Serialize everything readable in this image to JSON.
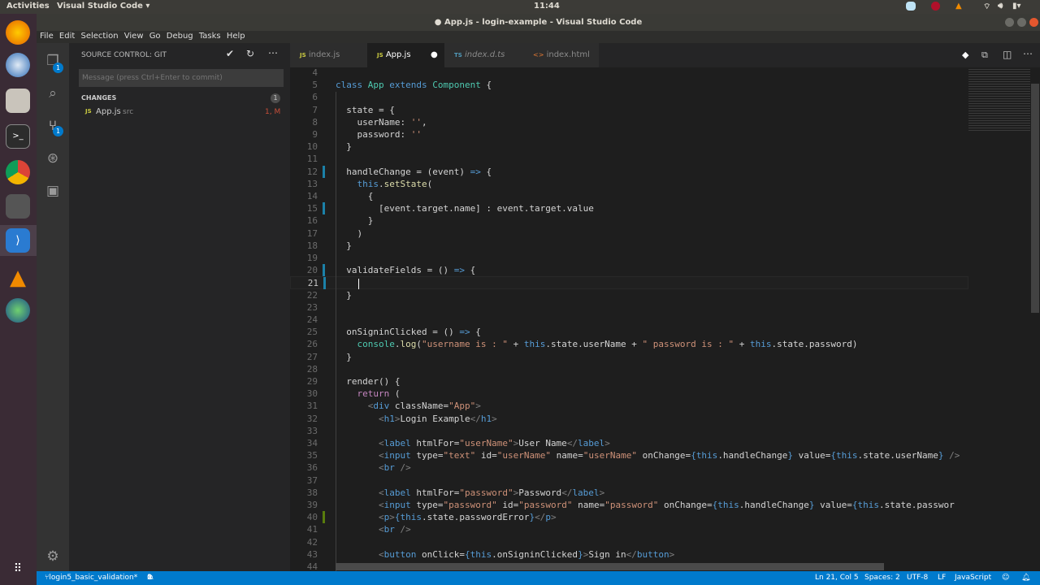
{
  "system": {
    "activities": "Activities",
    "app_menu": "Visual Studio Code ▾",
    "clock": "11:44"
  },
  "window": {
    "title": "● App.js - login-example - Visual Studio Code"
  },
  "menu": [
    "File",
    "Edit",
    "Selection",
    "View",
    "Go",
    "Debug",
    "Tasks",
    "Help"
  ],
  "activity": {
    "explorer_badge": "1",
    "git_badge": "1"
  },
  "sidebar": {
    "title": "SOURCE CONTROL: GIT",
    "commit_placeholder": "Message (press Ctrl+Enter to commit)",
    "changes_label": "CHANGES",
    "changes_count": "1",
    "files": [
      {
        "icon": "JS",
        "name": "App.js",
        "dir": "src",
        "status": "1, M"
      }
    ]
  },
  "tabs": [
    {
      "icon": "JS",
      "label": "index.js"
    },
    {
      "icon": "JS",
      "label": "App.js",
      "dirty": "●"
    },
    {
      "icon": "TS",
      "label": "index.d.ts"
    },
    {
      "icon": "<>",
      "label": "index.html"
    }
  ],
  "editor": {
    "cursor_line": 21,
    "lines": [
      [
        4,
        []
      ],
      [
        5,
        [
          [
            "class",
            "kw"
          ],
          [
            " ",
            "pl"
          ],
          [
            "App",
            "cls"
          ],
          [
            " ",
            "pl"
          ],
          [
            "extends",
            "kw"
          ],
          [
            " ",
            "pl"
          ],
          [
            "Component",
            "cls"
          ],
          [
            " {",
            "pl"
          ]
        ]
      ],
      [
        6,
        []
      ],
      [
        7,
        [
          [
            "  state = {",
            "pl"
          ]
        ]
      ],
      [
        8,
        [
          [
            "    userName: ",
            "pl"
          ],
          [
            "''",
            "str"
          ],
          [
            ",",
            "pl"
          ]
        ]
      ],
      [
        9,
        [
          [
            "    password: ",
            "pl"
          ],
          [
            "''",
            "str"
          ]
        ]
      ],
      [
        10,
        [
          [
            "  }",
            "pl"
          ]
        ]
      ],
      [
        11,
        []
      ],
      [
        12,
        [
          [
            "  handleChange = (event) ",
            "pl"
          ],
          [
            "=>",
            "kw"
          ],
          [
            " {",
            "pl"
          ]
        ]
      ],
      [
        13,
        [
          [
            "    ",
            "pl"
          ],
          [
            "this",
            "ths"
          ],
          [
            ".",
            "pl"
          ],
          [
            "setState",
            "fn"
          ],
          [
            "(",
            "pl"
          ]
        ]
      ],
      [
        14,
        [
          [
            "      {",
            "pl"
          ]
        ]
      ],
      [
        15,
        [
          [
            "        [event.target.name] : event.target.value",
            "pl"
          ]
        ]
      ],
      [
        16,
        [
          [
            "      }",
            "pl"
          ]
        ]
      ],
      [
        17,
        [
          [
            "    )",
            "pl"
          ]
        ]
      ],
      [
        18,
        [
          [
            "  }",
            "pl"
          ]
        ]
      ],
      [
        19,
        []
      ],
      [
        20,
        [
          [
            "  validateFields = () ",
            "pl"
          ],
          [
            "=>",
            "kw"
          ],
          [
            " {",
            "pl"
          ]
        ]
      ],
      [
        21,
        [
          [
            "    ",
            "pl"
          ]
        ]
      ],
      [
        22,
        [
          [
            "  }",
            "pl"
          ]
        ]
      ],
      [
        23,
        []
      ],
      [
        24,
        []
      ],
      [
        25,
        [
          [
            "  onSigninClicked = () ",
            "pl"
          ],
          [
            "=>",
            "kw"
          ],
          [
            " {",
            "pl"
          ]
        ]
      ],
      [
        26,
        [
          [
            "    ",
            "pl"
          ],
          [
            "console",
            "obj"
          ],
          [
            ".",
            "pl"
          ],
          [
            "log",
            "fn"
          ],
          [
            "(",
            "pl"
          ],
          [
            "\"username is : \"",
            "str"
          ],
          [
            " + ",
            "pl"
          ],
          [
            "this",
            "ths"
          ],
          [
            ".state.userName + ",
            "pl"
          ],
          [
            "\" password is : \"",
            "str"
          ],
          [
            " + ",
            "pl"
          ],
          [
            "this",
            "ths"
          ],
          [
            ".state.password)",
            "pl"
          ]
        ]
      ],
      [
        27,
        [
          [
            "  }",
            "pl"
          ]
        ]
      ],
      [
        28,
        []
      ],
      [
        29,
        [
          [
            "  render() {",
            "pl"
          ]
        ]
      ],
      [
        30,
        [
          [
            "    ",
            "pl"
          ],
          [
            "return",
            "ret"
          ],
          [
            " (",
            "pl"
          ]
        ]
      ],
      [
        31,
        [
          [
            "      ",
            "pl"
          ],
          [
            "<",
            "tg"
          ],
          [
            "div",
            "tn"
          ],
          [
            " className=",
            "at"
          ],
          [
            "\"App\"",
            "str"
          ],
          [
            ">",
            "tg"
          ]
        ]
      ],
      [
        32,
        [
          [
            "        ",
            "pl"
          ],
          [
            "<",
            "tg"
          ],
          [
            "h1",
            "tn"
          ],
          [
            ">",
            "tg"
          ],
          [
            "Login Example",
            "pl"
          ],
          [
            "</",
            "tg"
          ],
          [
            "h1",
            "tn"
          ],
          [
            ">",
            "tg"
          ]
        ]
      ],
      [
        33,
        []
      ],
      [
        34,
        [
          [
            "        ",
            "pl"
          ],
          [
            "<",
            "tg"
          ],
          [
            "label",
            "tn"
          ],
          [
            " htmlFor=",
            "at"
          ],
          [
            "\"userName\"",
            "str"
          ],
          [
            ">",
            "tg"
          ],
          [
            "User Name",
            "pl"
          ],
          [
            "</",
            "tg"
          ],
          [
            "label",
            "tn"
          ],
          [
            ">",
            "tg"
          ]
        ]
      ],
      [
        35,
        [
          [
            "        ",
            "pl"
          ],
          [
            "<",
            "tg"
          ],
          [
            "input",
            "tn"
          ],
          [
            " type=",
            "at"
          ],
          [
            "\"text\"",
            "str"
          ],
          [
            " id=",
            "at"
          ],
          [
            "\"userName\"",
            "str"
          ],
          [
            " name=",
            "at"
          ],
          [
            "\"userName\"",
            "str"
          ],
          [
            " onChange=",
            "at"
          ],
          [
            "{",
            "ths"
          ],
          [
            "this",
            "ths"
          ],
          [
            ".handleChange",
            "pl"
          ],
          [
            "}",
            "ths"
          ],
          [
            " value=",
            "at"
          ],
          [
            "{",
            "ths"
          ],
          [
            "this",
            "ths"
          ],
          [
            ".state.userName",
            "pl"
          ],
          [
            "}",
            "ths"
          ],
          [
            " />",
            "tg"
          ]
        ]
      ],
      [
        36,
        [
          [
            "        ",
            "pl"
          ],
          [
            "<",
            "tg"
          ],
          [
            "br",
            "tn"
          ],
          [
            " />",
            "tg"
          ]
        ]
      ],
      [
        37,
        []
      ],
      [
        38,
        [
          [
            "        ",
            "pl"
          ],
          [
            "<",
            "tg"
          ],
          [
            "label",
            "tn"
          ],
          [
            " htmlFor=",
            "at"
          ],
          [
            "\"password\"",
            "str"
          ],
          [
            ">",
            "tg"
          ],
          [
            "Password",
            "pl"
          ],
          [
            "</",
            "tg"
          ],
          [
            "label",
            "tn"
          ],
          [
            ">",
            "tg"
          ]
        ]
      ],
      [
        39,
        [
          [
            "        ",
            "pl"
          ],
          [
            "<",
            "tg"
          ],
          [
            "input",
            "tn"
          ],
          [
            " type=",
            "at"
          ],
          [
            "\"password\"",
            "str"
          ],
          [
            " id=",
            "at"
          ],
          [
            "\"password\"",
            "str"
          ],
          [
            " name=",
            "at"
          ],
          [
            "\"password\"",
            "str"
          ],
          [
            " onChange=",
            "at"
          ],
          [
            "{",
            "ths"
          ],
          [
            "this",
            "ths"
          ],
          [
            ".handleChange",
            "pl"
          ],
          [
            "}",
            "ths"
          ],
          [
            " value=",
            "at"
          ],
          [
            "{",
            "ths"
          ],
          [
            "this",
            "ths"
          ],
          [
            ".state.passwor",
            "pl"
          ]
        ]
      ],
      [
        40,
        [
          [
            "        ",
            "pl"
          ],
          [
            "<",
            "tg"
          ],
          [
            "p",
            "tn"
          ],
          [
            ">",
            "tg"
          ],
          [
            "{",
            "ths"
          ],
          [
            "this",
            "ths"
          ],
          [
            ".state.passwordError",
            "pl"
          ],
          [
            "}",
            "ths"
          ],
          [
            "</",
            "tg"
          ],
          [
            "p",
            "tn"
          ],
          [
            ">",
            "tg"
          ]
        ]
      ],
      [
        41,
        [
          [
            "        ",
            "pl"
          ],
          [
            "<",
            "tg"
          ],
          [
            "br",
            "tn"
          ],
          [
            " />",
            "tg"
          ]
        ]
      ],
      [
        42,
        []
      ],
      [
        43,
        [
          [
            "        ",
            "pl"
          ],
          [
            "<",
            "tg"
          ],
          [
            "button",
            "tn"
          ],
          [
            " onClick=",
            "at"
          ],
          [
            "{",
            "ths"
          ],
          [
            "this",
            "ths"
          ],
          [
            ".onSigninClicked",
            "pl"
          ],
          [
            "}",
            "ths"
          ],
          [
            ">",
            "tg"
          ],
          [
            "Sign in",
            "pl"
          ],
          [
            "</",
            "tg"
          ],
          [
            "button",
            "tn"
          ],
          [
            ">",
            "tg"
          ]
        ]
      ],
      [
        44,
        [
          [
            "      ",
            "pl"
          ],
          [
            "</",
            "tg"
          ],
          [
            "div",
            "tn"
          ],
          [
            ">",
            "tg"
          ]
        ]
      ]
    ],
    "gutter": {
      "12": "#1b81a8",
      "15": "#1b81a8",
      "20": "#1b81a8",
      "21": "#1b81a8",
      "40": "#587c0c"
    }
  },
  "status": {
    "branch": "login5_basic_validation*",
    "errors": "1",
    "warnings": "0",
    "position": "Ln 21, Col 5",
    "spaces": "Spaces: 2",
    "encoding": "UTF-8",
    "eol": "LF",
    "language": "JavaScript"
  },
  "colors": {
    "accent": "#007acc"
  }
}
